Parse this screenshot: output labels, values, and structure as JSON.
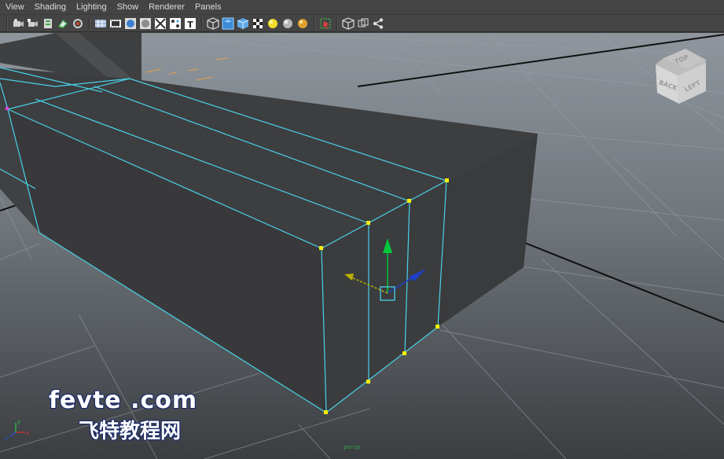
{
  "menu": {
    "items": [
      "View",
      "Shading",
      "Lighting",
      "Show",
      "Renderer",
      "Panels"
    ]
  },
  "toolbar": {
    "icons": [
      "select-camera-icon",
      "lock-camera-icon",
      "camera-attributes-icon",
      "bookmark-icon",
      "image-plane-icon",
      "grid-icon",
      "film-gate-icon",
      "resolution-gate-icon",
      "safe-action-icon",
      "field-chart-icon",
      "texture-placement-icon",
      "wireframe-icon",
      "smooth-shade-icon",
      "default-material-icon",
      "textured-icon",
      "use-all-lights-icon",
      "shadows-icon",
      "high-quality-icon",
      "isolate-select-icon",
      "xray-icon",
      "xray-joints-icon",
      "backface-icon"
    ]
  },
  "viewcube": {
    "face_back": "BACK",
    "face_left": "LEFT",
    "face_top": "TOP"
  },
  "watermark": {
    "line1": "fevte .com",
    "line2": "飞特教程网"
  },
  "axis": {
    "x_label": "x",
    "y_label": "y",
    "z_label": "z"
  },
  "camera_name": "persp",
  "colors": {
    "background_top": "#8e949b",
    "background_bottom": "#3b3d40",
    "selection": "#48d3e8",
    "vertex": "#f5f000",
    "move_y": "#00c83a",
    "move_z": "#1f3fc8",
    "move_x": "#b8b000"
  }
}
